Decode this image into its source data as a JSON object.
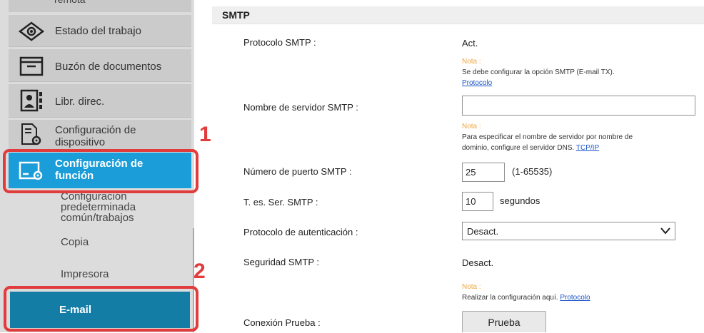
{
  "sidebar": {
    "top_partial": "remota",
    "items": [
      {
        "label": "Estado del trabajo",
        "icon": "eye-icon"
      },
      {
        "label": "Buzón de documentos",
        "icon": "folder-icon"
      },
      {
        "label": "Libr. direc.",
        "icon": "address-book-icon"
      },
      {
        "label": "Configuración de dispositivo",
        "icon": "device-settings-icon"
      },
      {
        "label": "Configuración de función",
        "icon": "function-settings-icon"
      }
    ],
    "sub_items": [
      {
        "label": "Configuración predeterminada común/trabajos"
      },
      {
        "label": "Copia"
      },
      {
        "label": "Impresora"
      },
      {
        "label": "E-mail"
      }
    ]
  },
  "callouts": {
    "first": "1",
    "second": "2"
  },
  "section": {
    "title": "SMTP"
  },
  "form": {
    "protocol": {
      "label": "Protocolo SMTP :",
      "value": "Act."
    },
    "note1": {
      "title": "Nota :",
      "text": "Se debe configurar la opción SMTP (E-mail TX).",
      "link": "Protocolo"
    },
    "server_name": {
      "label": "Nombre de servidor SMTP :",
      "value": ""
    },
    "note2": {
      "title": "Nota :",
      "line1": "Para especificar el nombre de servidor por nombre de",
      "line2": "dominio, configure el servidor DNS.",
      "link": "TCP/IP"
    },
    "port": {
      "label": "Número de puerto SMTP :",
      "value": "25",
      "range": "(1-65535)"
    },
    "timeout": {
      "label": "T. es. Ser. SMTP :",
      "value": "10",
      "unit": "segundos"
    },
    "auth": {
      "label": "Protocolo de autenticación :",
      "selected": "Desact."
    },
    "security": {
      "label": "Seguridad SMTP :",
      "value": "Desact."
    },
    "note3": {
      "title": "Nota :",
      "text": "Realizar la configuración aquí.",
      "link": "Protocolo"
    },
    "test": {
      "label": "Conexión Prueba :",
      "button": "Prueba"
    }
  },
  "colors": {
    "active": "#1a9dd9",
    "selected": "#137da6",
    "callout": "#e23b3b",
    "note_title": "#f2a640",
    "link": "#1a55c9"
  }
}
